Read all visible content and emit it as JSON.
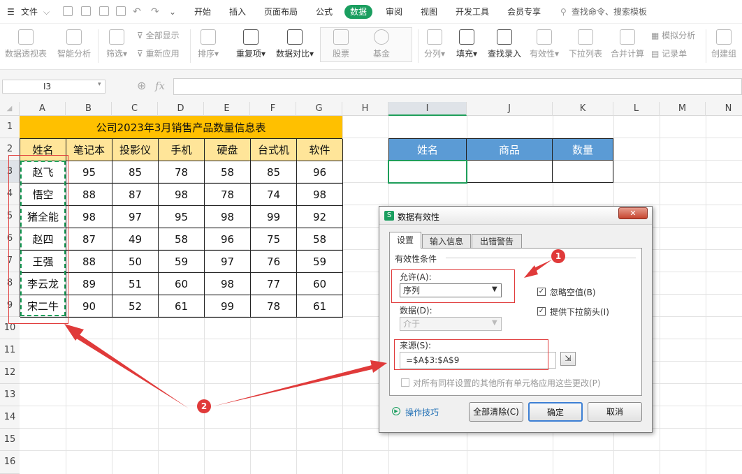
{
  "menubar": {
    "file": "文件",
    "items": [
      "开始",
      "插入",
      "页面布局",
      "公式",
      "数据",
      "审阅",
      "视图",
      "开发工具",
      "会员专享"
    ],
    "active": "数据",
    "search": "查找命令、搜索模板"
  },
  "ribbon": {
    "pivot": "数据透视表",
    "smart": "智能分析",
    "filter": "筛选",
    "show_all": "全部显示",
    "reapply": "重新应用",
    "sort": "排序",
    "dup": "重复项",
    "compare": "数据对比",
    "stock": "股票",
    "fund": "基金",
    "split": "分列",
    "fill": "填充",
    "lookup": "查找录入",
    "validity": "有效性",
    "dropdown": "下拉列表",
    "consolidate": "合并计算",
    "simulate": "模拟分析",
    "record": "记录单",
    "group": "创建组"
  },
  "formula_bar": {
    "cell_ref": "I3",
    "fx": "fx",
    "value": ""
  },
  "columns": [
    "A",
    "B",
    "C",
    "D",
    "E",
    "F",
    "G",
    "H",
    "I",
    "J",
    "K",
    "L",
    "M",
    "N"
  ],
  "rows": [
    "1",
    "2",
    "3",
    "4",
    "5",
    "6",
    "7",
    "8",
    "9",
    "10",
    "11",
    "12",
    "13",
    "14",
    "15",
    "16"
  ],
  "table": {
    "title": "公司2023年3月销售产品数量信息表",
    "headers": [
      "姓名",
      "笔记本",
      "投影仪",
      "手机",
      "硬盘",
      "台式机",
      "软件"
    ],
    "rows": [
      [
        "赵飞",
        "95",
        "85",
        "78",
        "58",
        "85",
        "96"
      ],
      [
        "悟空",
        "88",
        "87",
        "98",
        "78",
        "74",
        "98"
      ],
      [
        "猪全能",
        "98",
        "97",
        "95",
        "98",
        "99",
        "92"
      ],
      [
        "赵四",
        "87",
        "49",
        "58",
        "96",
        "75",
        "58"
      ],
      [
        "王强",
        "88",
        "50",
        "59",
        "97",
        "76",
        "59"
      ],
      [
        "李云龙",
        "89",
        "51",
        "60",
        "98",
        "77",
        "60"
      ],
      [
        "宋二牛",
        "90",
        "52",
        "61",
        "99",
        "78",
        "61"
      ]
    ]
  },
  "lookup_table": {
    "headers": [
      "姓名",
      "商品",
      "数量"
    ]
  },
  "dialog": {
    "title": "数据有效性",
    "tabs": [
      "设置",
      "输入信息",
      "出错警告"
    ],
    "section": "有效性条件",
    "allow_label": "允许(A):",
    "allow_value": "序列",
    "ignore_blank": "忽略空值(B)",
    "dropdown_arrow": "提供下拉箭头(I)",
    "data_label": "数据(D):",
    "data_value": "介于",
    "source_label": "来源(S):",
    "source_value": "=$A$3:$A$9",
    "apply_all": "对所有同样设置的其他所有单元格应用这些更改(P)",
    "tips": "操作技巧",
    "clear_all": "全部清除(C)",
    "ok": "确定",
    "cancel": "取消"
  },
  "annotations": [
    "1",
    "2"
  ],
  "colors": {
    "accent": "#1a9e5f",
    "title_fill": "#ffc000",
    "header_fill": "#ffe599",
    "blue_header": "#5b9bd5",
    "annotation_red": "#e03a3a"
  }
}
